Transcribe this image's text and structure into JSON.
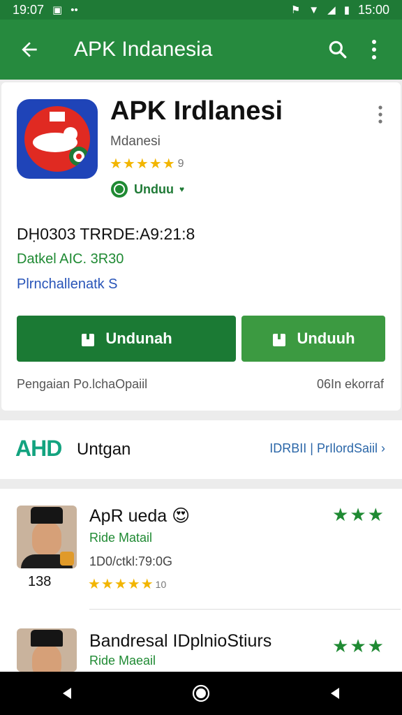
{
  "status": {
    "time": "19:07",
    "battery_text": "15:00"
  },
  "appbar": {
    "title": "APK Indanesia"
  },
  "app": {
    "name": "APK Irdlanesi",
    "developer": "Mdanesi",
    "rating_stars": "★★★★★",
    "rating_num": "9",
    "badge_label": "Unduu",
    "info_line1": "DḤ0303 TRRDE:A9:21:8",
    "info_line2": "Datkel AIC. 3R30",
    "info_line3": "Plrnchallenatk S",
    "primary_button": "Undunah",
    "secondary_button": "Unduuh",
    "footer_left": "Pengaian Po.lchaOpaiil",
    "footer_right": "06In ekorraf"
  },
  "section": {
    "logo": "AHD",
    "title": "Untgan",
    "link": "IDRBII | PrIlordSaiil ›"
  },
  "reviews": [
    {
      "name": "ApR ueda 😍",
      "subtitle": "Ride Matail",
      "date": "1D0/ctkl:79:0G",
      "count": "138",
      "stars": "★★★★★",
      "star_num": "10",
      "right_stars": "★★★"
    },
    {
      "name": "Bandresal IDplnioStiurs",
      "subtitle": "Ride Maeail",
      "right_stars": "★★★"
    }
  ],
  "colors": {
    "primary_green": "#268a3e",
    "status_green": "#1f7a36",
    "accent_link": "#2a66a8",
    "star_yellow": "#f2b500"
  },
  "icons": {
    "back": "arrow-left-icon",
    "search": "search-icon",
    "menu": "more-vert-icon",
    "nav_back": "triangle-left-icon",
    "nav_home": "circle-home-icon",
    "nav_recent": "triangle-left-icon"
  }
}
